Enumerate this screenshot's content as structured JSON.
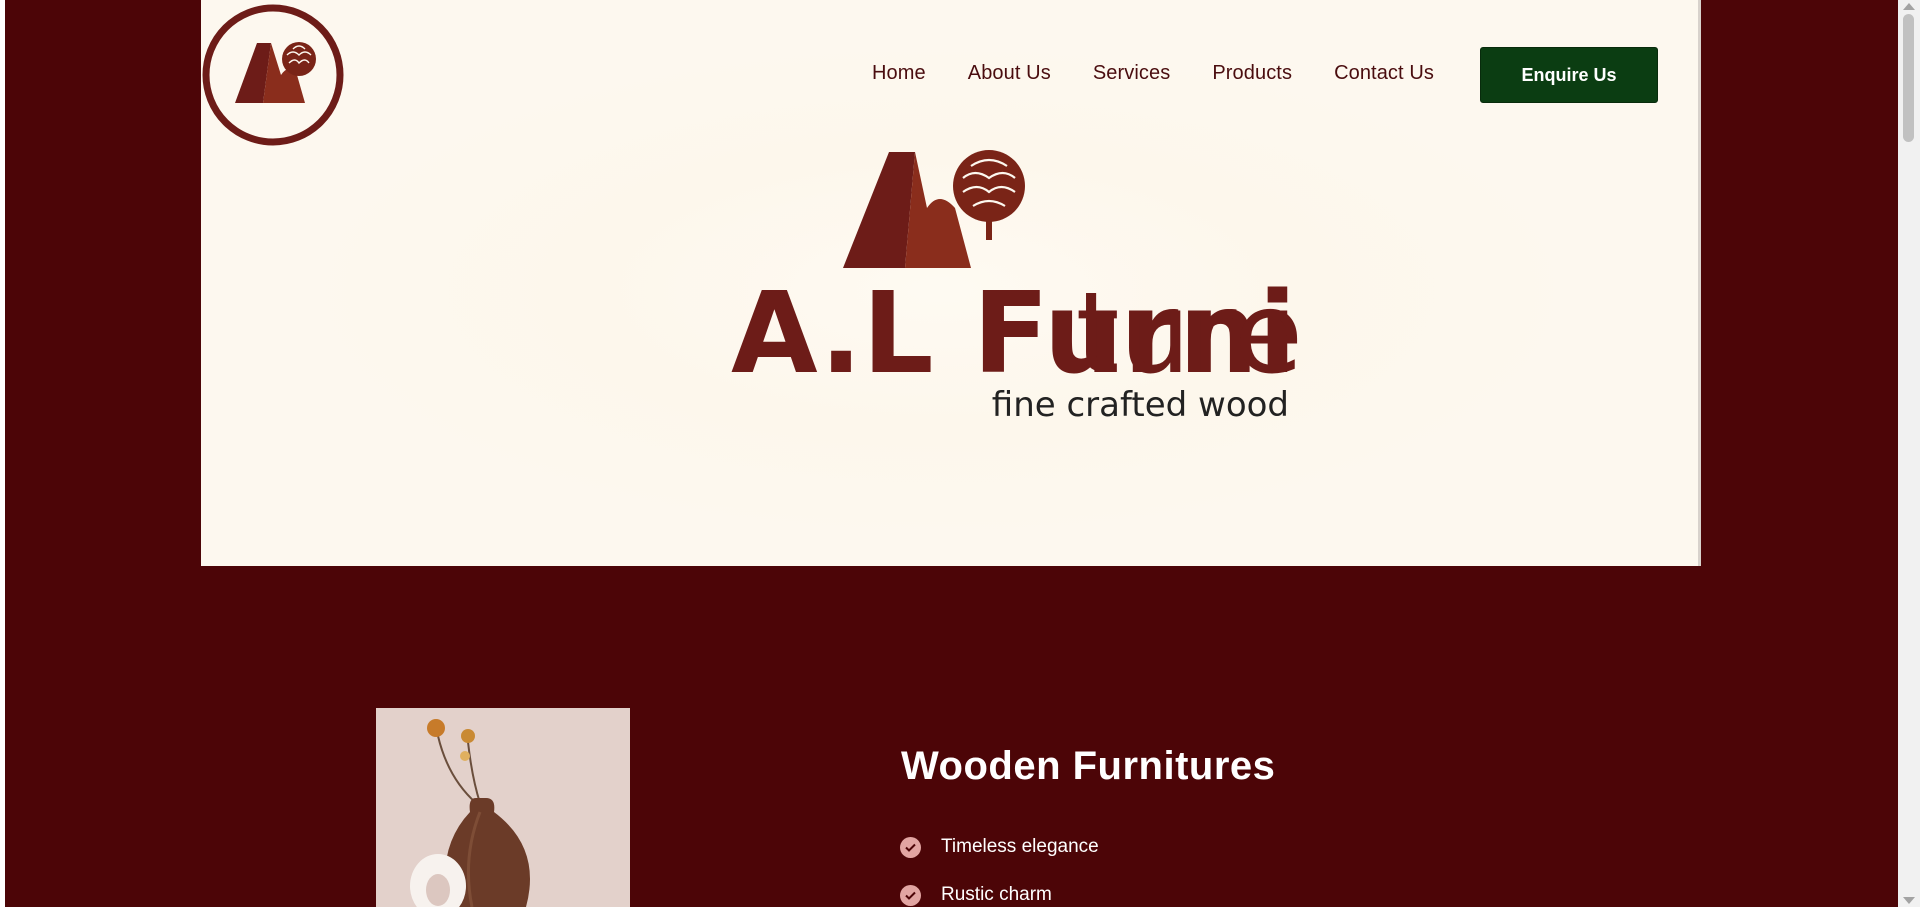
{
  "nav": {
    "items": [
      {
        "label": "Home"
      },
      {
        "label": "About Us"
      },
      {
        "label": "Services"
      },
      {
        "label": "Products"
      },
      {
        "label": "Contact Us"
      }
    ],
    "cta_label": "Enquire Us"
  },
  "logo": {
    "brand": "A.L Furniture",
    "brand_bold": "A.L Furni",
    "brand_light": "ture",
    "tagline": "fine crafted wood"
  },
  "section": {
    "title": "Wooden Furnitures",
    "features": [
      {
        "label": "Timeless elegance"
      },
      {
        "label": "Rustic charm"
      }
    ]
  },
  "colors": {
    "page_bg": "#4c0507",
    "hero_bg": "#fdf8ef",
    "brand": "#7a2417",
    "cta_bg": "#0b3d12",
    "check": "#e2a5a2"
  },
  "icons": [
    "al-monogram-logo",
    "tree-icon",
    "check-icon"
  ]
}
